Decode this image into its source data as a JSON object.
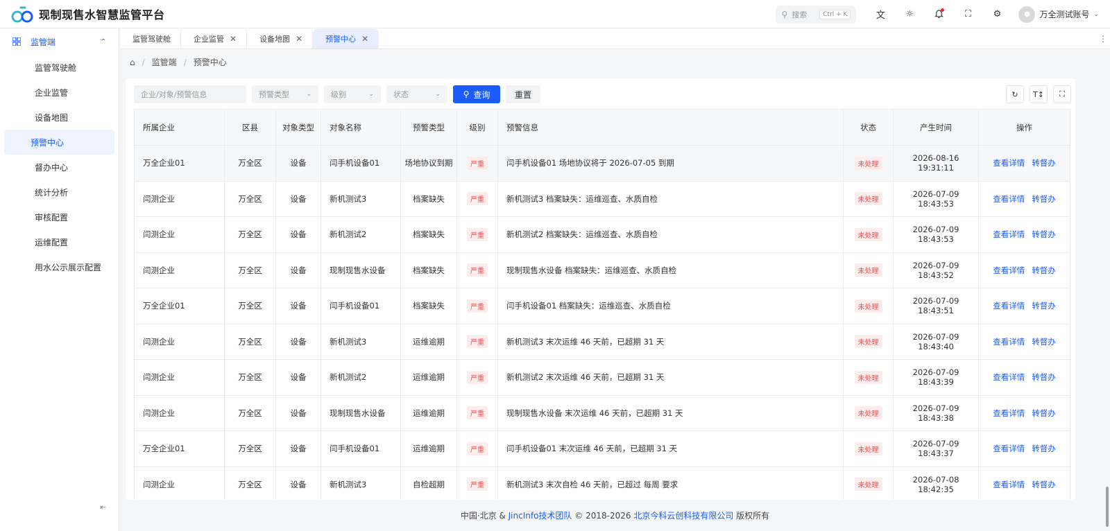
{
  "app": {
    "title": "现制现售水智慧监管平台"
  },
  "header": {
    "search_label": "搜索",
    "search_shortcut": "Ctrl + K",
    "user_name": "万全测试账号"
  },
  "sidebar": {
    "group_label": "监管端",
    "items": [
      {
        "label": "监管驾驶舱"
      },
      {
        "label": "企业监管"
      },
      {
        "label": "设备地图"
      },
      {
        "label": "预警中心"
      },
      {
        "label": "督办中心"
      },
      {
        "label": "统计分析"
      },
      {
        "label": "审核配置"
      },
      {
        "label": "运维配置"
      },
      {
        "label": "用水公示展示配置"
      }
    ]
  },
  "tabs": [
    {
      "label": "监管驾驶舱"
    },
    {
      "label": "企业监管"
    },
    {
      "label": "设备地图"
    },
    {
      "label": "预警中心"
    }
  ],
  "breadcrumb": {
    "parent": "监管端",
    "current": "预警中心"
  },
  "filters": {
    "keyword_placeholder": "企业/对象/预警信息",
    "type_placeholder": "预警类型",
    "level_placeholder": "级别",
    "status_placeholder": "状态",
    "query_label": "查询",
    "reset_label": "重置"
  },
  "table": {
    "headers": [
      "所属企业",
      "区县",
      "对象类型",
      "对象名称",
      "预警类型",
      "级别",
      "预警信息",
      "状态",
      "产生时间",
      "操作"
    ],
    "rows": [
      {
        "company": "万全企业01",
        "district": "万全区",
        "obj_type": "设备",
        "obj_name": "闫手机设备01",
        "alert_type": "场地协议到期",
        "level": "严重",
        "info": "闫手机设备01 场地协议将于 2026-07-05 到期",
        "status": "未处理",
        "time": "2026-08-16 19:31:11"
      },
      {
        "company": "闫测企业",
        "district": "万全区",
        "obj_type": "设备",
        "obj_name": "新机测试3",
        "alert_type": "档案缺失",
        "level": "严重",
        "info": "新机测试3 档案缺失：运维巡查、水质自检",
        "status": "未处理",
        "time": "2026-07-09 18:43:53"
      },
      {
        "company": "闫测企业",
        "district": "万全区",
        "obj_type": "设备",
        "obj_name": "新机测试2",
        "alert_type": "档案缺失",
        "level": "严重",
        "info": "新机测试2 档案缺失：运维巡查、水质自检",
        "status": "未处理",
        "time": "2026-07-09 18:43:53"
      },
      {
        "company": "闫测企业",
        "district": "万全区",
        "obj_type": "设备",
        "obj_name": "现制现售水设备",
        "alert_type": "档案缺失",
        "level": "严重",
        "info": "现制现售水设备 档案缺失：运维巡查、水质自检",
        "status": "未处理",
        "time": "2026-07-09 18:43:52"
      },
      {
        "company": "万全企业01",
        "district": "万全区",
        "obj_type": "设备",
        "obj_name": "闫手机设备01",
        "alert_type": "档案缺失",
        "level": "严重",
        "info": "闫手机设备01 档案缺失：运维巡查、水质自检",
        "status": "未处理",
        "time": "2026-07-09 18:43:51"
      },
      {
        "company": "闫测企业",
        "district": "万全区",
        "obj_type": "设备",
        "obj_name": "新机测试3",
        "alert_type": "运维逾期",
        "level": "严重",
        "info": "新机测试3 末次运维 46 天前，已超期 31 天",
        "status": "未处理",
        "time": "2026-07-09 18:43:40"
      },
      {
        "company": "闫测企业",
        "district": "万全区",
        "obj_type": "设备",
        "obj_name": "新机测试2",
        "alert_type": "运维逾期",
        "level": "严重",
        "info": "新机测试2 末次运维 46 天前，已超期 31 天",
        "status": "未处理",
        "time": "2026-07-09 18:43:39"
      },
      {
        "company": "闫测企业",
        "district": "万全区",
        "obj_type": "设备",
        "obj_name": "现制现售水设备",
        "alert_type": "运维逾期",
        "level": "严重",
        "info": "现制现售水设备 末次运维 46 天前，已超期 31 天",
        "status": "未处理",
        "time": "2026-07-09 18:43:38"
      },
      {
        "company": "万全企业01",
        "district": "万全区",
        "obj_type": "设备",
        "obj_name": "闫手机设备01",
        "alert_type": "运维逾期",
        "level": "严重",
        "info": "闫手机设备01 末次运维 46 天前，已超期 31 天",
        "status": "未处理",
        "time": "2026-07-09 18:43:37"
      },
      {
        "company": "闫测企业",
        "district": "万全区",
        "obj_type": "设备",
        "obj_name": "新机测试3",
        "alert_type": "自检超期",
        "level": "严重",
        "info": "新机测试3 末次自检 46 天前，已超过 每周 要求",
        "status": "未处理",
        "time": "2026-07-08 18:42:35"
      }
    ],
    "actions": {
      "view": "查看详情",
      "escalate": "转督办"
    }
  },
  "footer": {
    "prefix": "中国·北京 &",
    "team": "JincInfo技术团队",
    "copyright": "© 2018-2026",
    "company": "北京今科云创科技有限公司",
    "suffix": "版权所有"
  },
  "colors": {
    "primary": "#1a5cff",
    "danger": "#f05050",
    "danger_bg": "#fdecec"
  }
}
